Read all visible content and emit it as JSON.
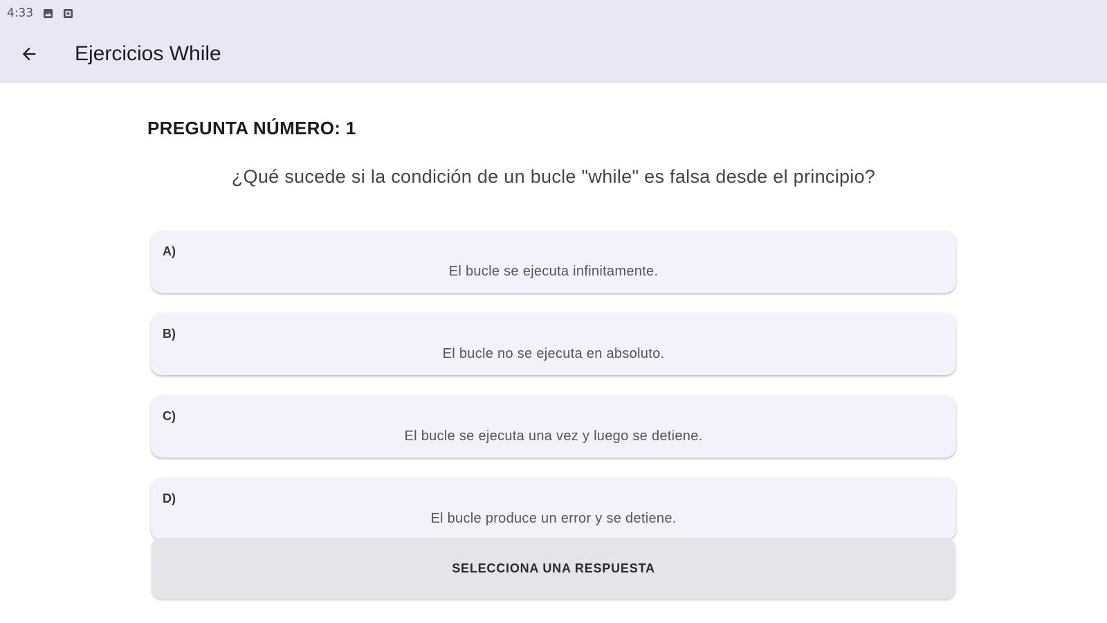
{
  "status_bar": {
    "time": "4:33",
    "icons": [
      "image-icon",
      "notification-icon"
    ]
  },
  "app_bar": {
    "back_icon": "arrow-left-icon",
    "title": "Ejercicios While",
    "background": "#e9e6f6"
  },
  "question": {
    "number_label": "PREGUNTA NÚMERO: 1",
    "text": "¿Qué sucede si la condición de un bucle \"while\" es falsa desde el principio?"
  },
  "options": [
    {
      "letter": "A)",
      "text": "El bucle se ejecuta infinitamente."
    },
    {
      "letter": "B)",
      "text": "El bucle no se ejecuta en absoluto."
    },
    {
      "letter": "C)",
      "text": "El bucle se ejecuta una vez y luego se detiene."
    },
    {
      "letter": "D)",
      "text": "El bucle produce un error y se detiene."
    }
  ],
  "submit": {
    "label": "SELECCIONA UNA RESPUESTA"
  }
}
